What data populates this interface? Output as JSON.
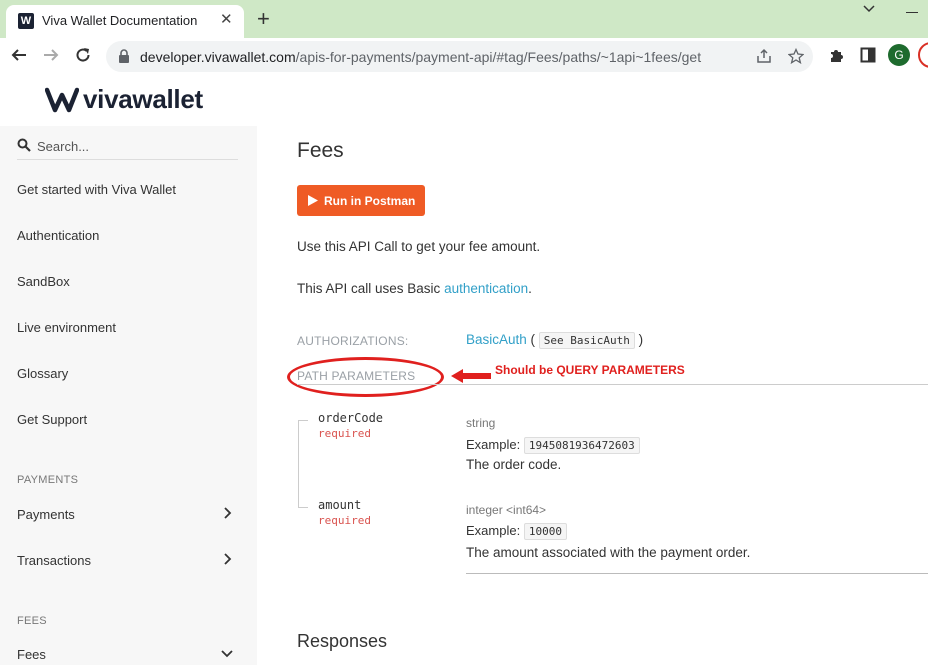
{
  "browser": {
    "tab_title": "Viva Wallet Documentation",
    "tab_favicon_letter": "W",
    "url_host": "developer.vivawallet.com",
    "url_path": "/apis-for-payments/payment-api/#tag/Fees/paths/~1api~1fees/get",
    "profile_initial": "G"
  },
  "brand": {
    "logo_text": "vivawallet"
  },
  "sidebar": {
    "search_placeholder": "Search...",
    "items": [
      {
        "label": "Get started with Viva Wallet"
      },
      {
        "label": "Authentication"
      },
      {
        "label": "SandBox"
      },
      {
        "label": "Live environment"
      },
      {
        "label": "Glossary"
      },
      {
        "label": "Get Support"
      }
    ],
    "payments_heading": "PAYMENTS",
    "payments_items": [
      {
        "label": "Payments"
      },
      {
        "label": "Transactions"
      }
    ],
    "fees_heading": "FEES",
    "fees_items": [
      {
        "label": "Fees"
      }
    ]
  },
  "main": {
    "title": "Fees",
    "postman_label": "Run in Postman",
    "description": "Use this API Call to get your fee amount.",
    "auth_prefix": "This API call uses Basic ",
    "auth_link": "authentication",
    "auth_suffix": ".",
    "authorizations_label": "AUTHORIZATIONS:",
    "authorizations_link": "BasicAuth",
    "authorizations_open": " ( ",
    "authorizations_chip": "See BasicAuth",
    "authorizations_close": " )",
    "path_params_label": "PATH PARAMETERS",
    "params": [
      {
        "name": "orderCode",
        "required": "required",
        "type": "string",
        "example_label": "Example:",
        "example": "1945081936472603",
        "description": "The order code."
      },
      {
        "name": "amount",
        "required": "required",
        "type": "integer <int64>",
        "example_label": "Example:",
        "example": "10000",
        "description": "The amount associated with the payment order."
      }
    ],
    "responses_title": "Responses"
  },
  "annotation": {
    "text": "Should be QUERY PARAMETERS",
    "color": "#e0201e"
  },
  "colors": {
    "postman": "#ef5b25",
    "link": "#32a0c8",
    "tabstrip": "#cfe8c6"
  }
}
